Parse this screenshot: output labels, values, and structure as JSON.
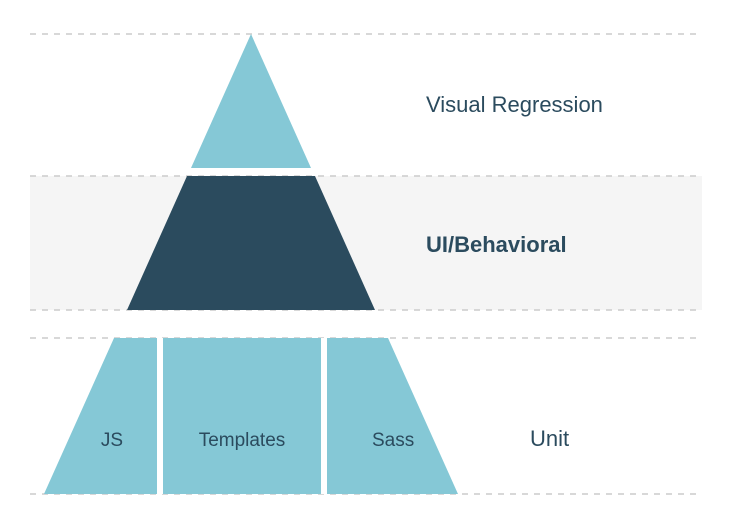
{
  "chart_data": {
    "type": "pyramid",
    "title": "",
    "tiers": [
      {
        "label": "Visual Regression",
        "highlighted": false,
        "sublabels": []
      },
      {
        "label": "UI/Behavioral",
        "highlighted": true,
        "sublabels": []
      },
      {
        "label": "Unit",
        "highlighted": false,
        "sublabels": [
          "JS",
          "Templates",
          "Sass"
        ]
      }
    ],
    "colors": {
      "light": "#85c8d6",
      "dark": "#2b4b5e",
      "highlight_bg": "#f5f5f5",
      "guide": "#cccccc",
      "sub_divider": "#ffffff",
      "text": "#2b4b5e"
    }
  }
}
